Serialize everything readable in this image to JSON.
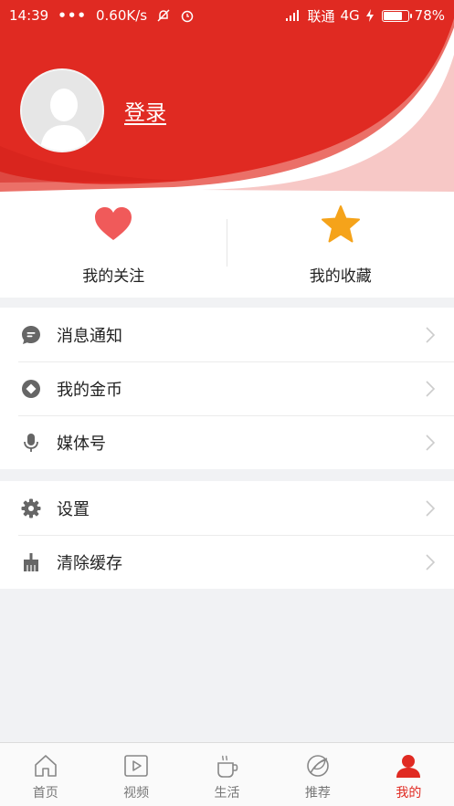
{
  "status_bar": {
    "time": "14:39",
    "dots": "•••",
    "speed": "0.60K/s",
    "carrier": "联通",
    "network": "4G",
    "battery": "78%",
    "battery_level": 0.78
  },
  "profile": {
    "login_label": "登录"
  },
  "quick_actions": [
    {
      "label": "我的关注",
      "icon": "heart-icon",
      "color": "#f05a5a"
    },
    {
      "label": "我的收藏",
      "icon": "star-icon",
      "color": "#f5a31a"
    }
  ],
  "menu_group_1": [
    {
      "label": "消息通知",
      "icon": "message-icon"
    },
    {
      "label": "我的金币",
      "icon": "coin-icon"
    },
    {
      "label": "媒体号",
      "icon": "microphone-icon"
    }
  ],
  "menu_group_2": [
    {
      "label": "设置",
      "icon": "gear-icon"
    },
    {
      "label": "清除缓存",
      "icon": "broom-icon"
    }
  ],
  "bottom_nav": [
    {
      "label": "首页",
      "icon": "home-icon",
      "active": false
    },
    {
      "label": "视频",
      "icon": "video-icon",
      "active": false
    },
    {
      "label": "生活",
      "icon": "cup-icon",
      "active": false
    },
    {
      "label": "推荐",
      "icon": "leaf-icon",
      "active": false
    },
    {
      "label": "我的",
      "icon": "user-icon",
      "active": true
    }
  ],
  "colors": {
    "brand_red": "#e02a22",
    "icon_gray": "#666666",
    "chevron_gray": "#cccccc",
    "page_bg": "#f1f2f4"
  }
}
